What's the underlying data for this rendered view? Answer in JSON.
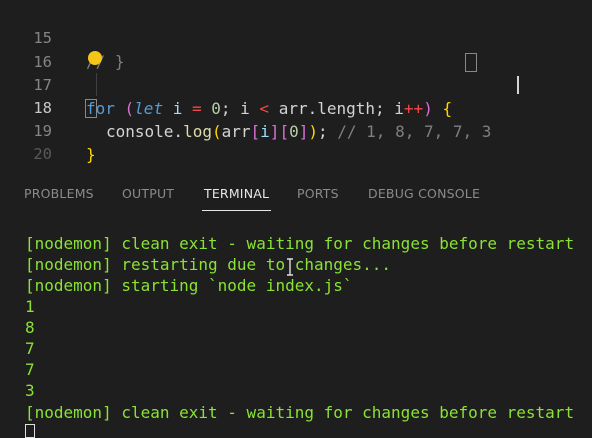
{
  "editor": {
    "lines": [
      {
        "number": "15",
        "text": "// }"
      },
      {
        "number": "16",
        "text": ""
      },
      {
        "number": "17",
        "t_for": "for",
        "t_open": " (",
        "t_let": "let",
        "t_i": " i ",
        "t_eq": "=",
        "t_zero": " 0",
        "t_semi1": "; i ",
        "t_lt": "<",
        "t_arr": " arr.length; i",
        "t_pp": "++",
        "t_close": ") ",
        "t_brace": "{"
      },
      {
        "number": "18",
        "t_console": "console.",
        "t_log": "log",
        "t_p1": "(",
        "t_arr": "arr",
        "t_b1": "[",
        "t_i": "i",
        "t_b2": "]",
        "t_b3": "[",
        "t_zero": "0",
        "t_b4": "]",
        "t_p2": ")",
        "t_semi": ";",
        "t_comment": " // 1, 8, 7, 7, 3"
      },
      {
        "number": "19",
        "text": "}"
      },
      {
        "number": "20",
        "text": ""
      }
    ]
  },
  "panel": {
    "tabs": [
      "PROBLEMS",
      "OUTPUT",
      "TERMINAL",
      "PORTS",
      "DEBUG CONSOLE"
    ],
    "active_tab": "TERMINAL"
  },
  "terminal": {
    "lines": [
      "[nodemon] clean exit - waiting for changes before restart",
      "[nodemon] restarting due to changes...",
      "[nodemon] starting `node index.js`",
      "1",
      "8",
      "7",
      "7",
      "3",
      "[nodemon] clean exit - waiting for changes before restart"
    ]
  },
  "colors": {
    "background": "#1e1e1e",
    "terminal_text": "#8ae234",
    "keyword": "#569cd6",
    "number": "#b5cea8",
    "operator": "#f44747",
    "comment": "#7f7f7f",
    "bracket_gold": "#ffd700",
    "bracket_purple": "#da70d6",
    "bracket_blue": "#179fff"
  }
}
